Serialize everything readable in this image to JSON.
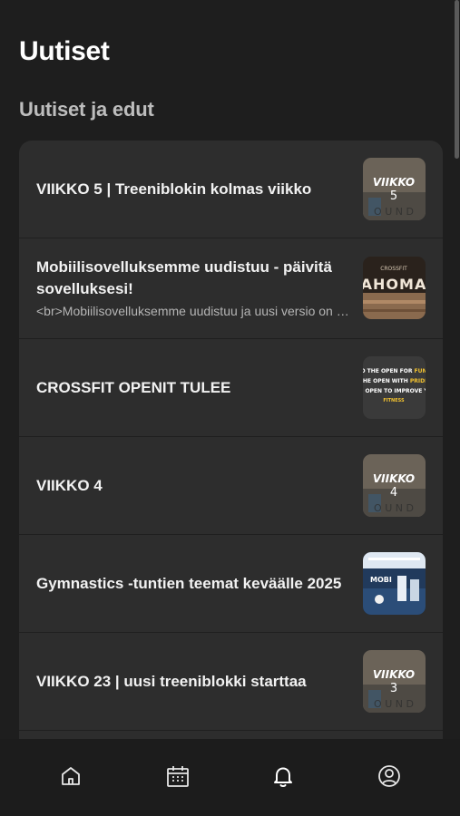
{
  "page": {
    "title": "Uutiset",
    "section_title": "Uutiset ja edut"
  },
  "news": [
    {
      "title": "VIIKKO 5 | Treeniblokin kolmas viikko",
      "snippet": "",
      "thumb_text": "VIIKKO",
      "thumb_number": "5"
    },
    {
      "title": "Mobiilisovelluksemme uudistuu - päivitä sovelluksesi!",
      "snippet": "<br>Mobiilisovelluksemme uudistuu ja uusi versio on nyt saatavilla",
      "thumb_text": "CROSSFIT AHOMA",
      "thumb_number": ""
    },
    {
      "title": "CROSSFIT OPENIT TULEE",
      "snippet": "",
      "thumb_text": "TO THE OPEN FOR FUN / THE OPEN WITH PRIDE / THE OPEN TO IMPROVE / FITNESS",
      "thumb_number": ""
    },
    {
      "title": "VIIKKO 4",
      "snippet": "",
      "thumb_text": "VIIKKO",
      "thumb_number": "4"
    },
    {
      "title": "Gymnastics -tuntien teemat keväälle 2025",
      "snippet": "",
      "thumb_text": "",
      "thumb_number": ""
    },
    {
      "title": "VIIKKO 23 | uusi treeniblokki starttaa",
      "snippet": "",
      "thumb_text": "VIIKKO",
      "thumb_number": "3"
    }
  ],
  "tabs": [
    {
      "icon": "home-icon"
    },
    {
      "icon": "calendar-icon"
    },
    {
      "icon": "bell-icon"
    },
    {
      "icon": "profile-icon"
    }
  ],
  "colors": {
    "background": "#1e1e1e",
    "card": "#2d2d2d",
    "accent": "#f2c230",
    "muted": "#bdbdbd"
  }
}
